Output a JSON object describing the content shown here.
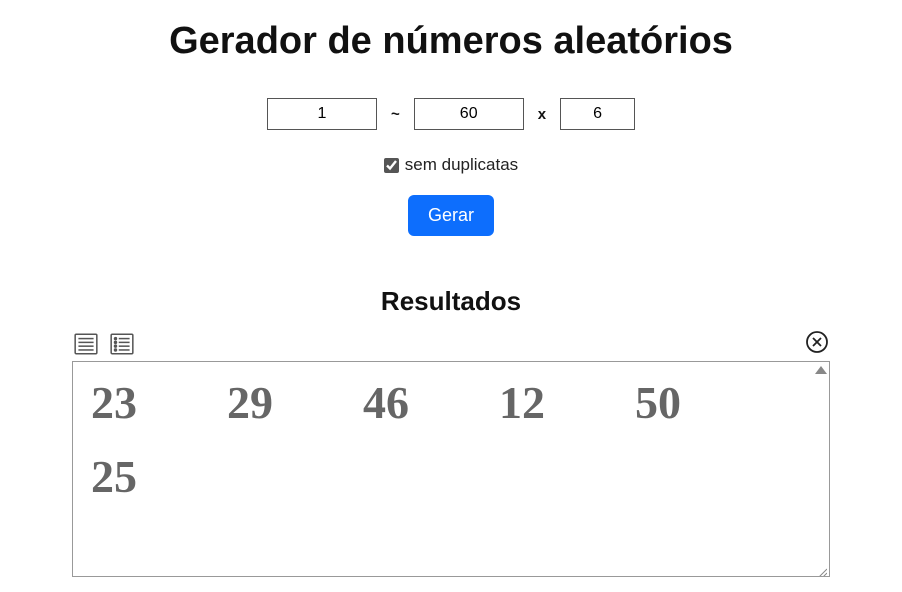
{
  "header": {
    "title": "Gerador de números aleatórios"
  },
  "inputs": {
    "min": "1",
    "range_sep": "~",
    "max": "60",
    "count_sep": "x",
    "count": "6"
  },
  "options": {
    "no_duplicates_label": "sem duplicatas",
    "no_duplicates_checked": true
  },
  "actions": {
    "generate_label": "Gerar"
  },
  "results": {
    "title": "Resultados",
    "numbers": [
      "23",
      "29",
      "46",
      "12",
      "50",
      "25"
    ]
  }
}
